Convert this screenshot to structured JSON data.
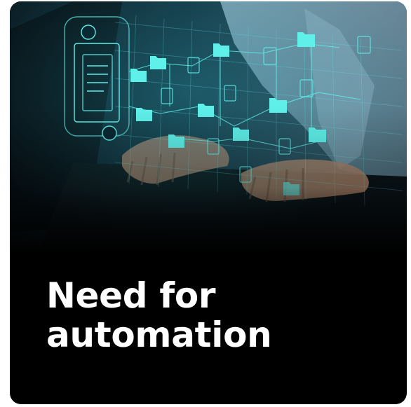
{
  "card": {
    "title_lines": [
      "Need for",
      "automation"
    ]
  },
  "image": {
    "subject": "hands-typing-on-laptop-with-holographic-file-network",
    "colors": {
      "background": "#000000",
      "title_text": "#ffffff",
      "holo_accent": "#5ff0ea",
      "holo_line": "#3fb8c4",
      "shirt": "#6f8fa3"
    }
  }
}
